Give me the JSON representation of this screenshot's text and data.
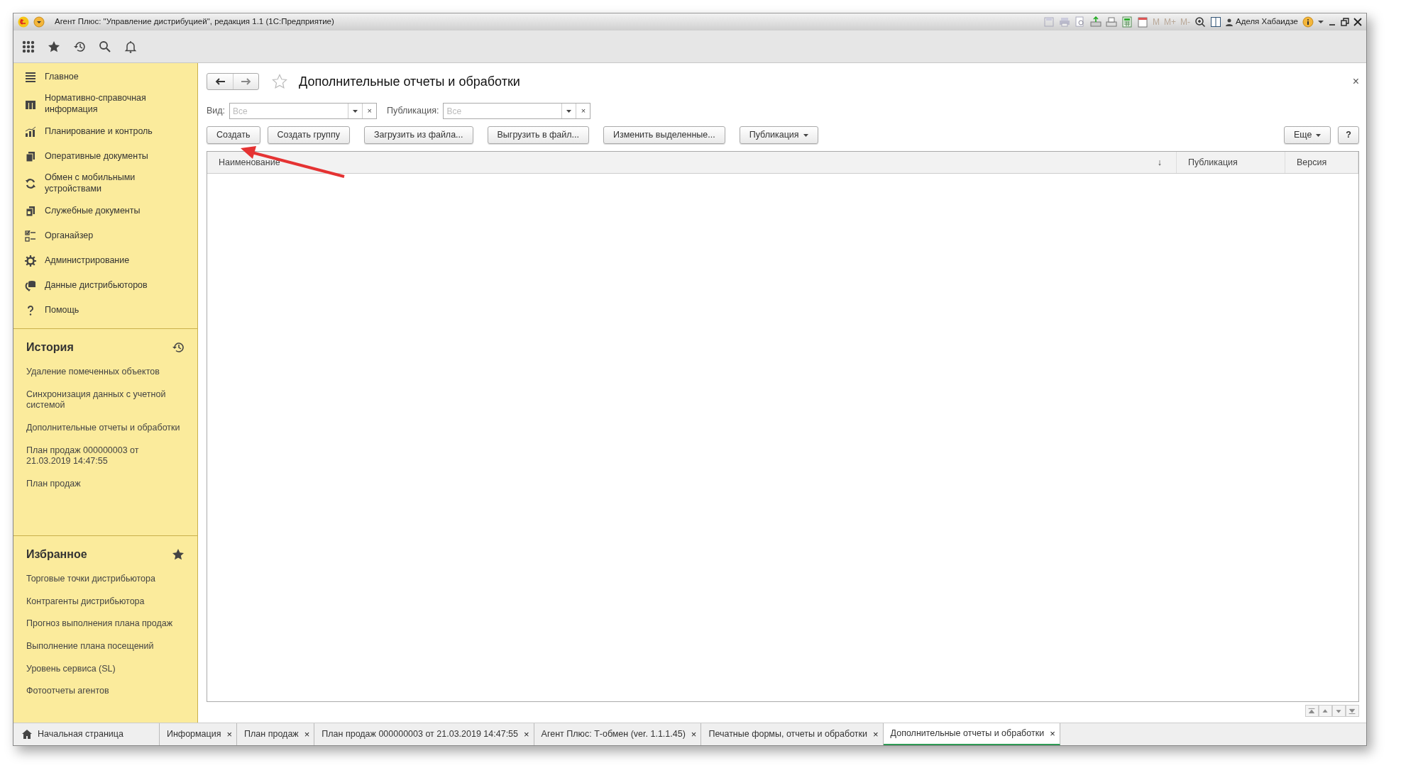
{
  "window": {
    "title": "Агент Плюс: \"Управление дистрибуцией\", редакция 1.1  (1С:Предприятие)",
    "memory_buttons": [
      "M",
      "M+",
      "M-"
    ],
    "user": "Аделя Хабаидзе"
  },
  "sidebar": {
    "items": [
      {
        "label": "Главное"
      },
      {
        "label": "Нормативно-справочная информация"
      },
      {
        "label": "Планирование и контроль"
      },
      {
        "label": "Оперативные документы"
      },
      {
        "label": "Обмен с мобильными устройствами"
      },
      {
        "label": "Служебные документы"
      },
      {
        "label": "Органайзер"
      },
      {
        "label": "Администрирование"
      },
      {
        "label": "Данные дистрибьюторов"
      },
      {
        "label": "Помощь"
      }
    ],
    "history": {
      "title": "История",
      "items": [
        "Удаление помеченных объектов",
        "Синхронизация данных с учетной системой",
        "Дополнительные отчеты и обработки",
        "План продаж 000000003 от 21.03.2019 14:47:55",
        "План продаж"
      ]
    },
    "favorites": {
      "title": "Избранное",
      "items": [
        "Торговые точки дистрибьютора",
        "Контрагенты дистрибьютора",
        "Прогноз выполнения плана продаж",
        "Выполнение плана посещений",
        "Уровень сервиса (SL)",
        "Фотоотчеты агентов"
      ]
    }
  },
  "form": {
    "title": "Дополнительные отчеты и обработки",
    "close": "×",
    "filters": [
      {
        "label": "Вид:",
        "placeholder": "Все",
        "clear": "×"
      },
      {
        "label": "Публикация:",
        "placeholder": "Все",
        "clear": "×"
      }
    ],
    "buttons": [
      {
        "label": "Создать",
        "kind": "plain"
      },
      {
        "label": "Создать группу",
        "kind": "plain"
      },
      {
        "label": "Загрузить из файла...",
        "kind": "plain"
      },
      {
        "label": "Выгрузить в файл...",
        "kind": "plain"
      },
      {
        "label": "Изменить выделенные...",
        "kind": "plain"
      },
      {
        "label": "Публикация",
        "kind": "dropdown"
      }
    ],
    "more_button": {
      "label": "Еще",
      "kind": "dropdown"
    },
    "help_button": "?",
    "table": {
      "columns": [
        {
          "label": "Наименование",
          "sort": "↓"
        },
        {
          "label": "Публикация"
        },
        {
          "label": "Версия"
        }
      ]
    }
  },
  "tabs": [
    {
      "label": "Начальная страница",
      "kind": "home",
      "selected": false
    },
    {
      "label": "Информация",
      "close": "×",
      "selected": false
    },
    {
      "label": "План продаж",
      "close": "×",
      "selected": false
    },
    {
      "label": "План продаж 000000003 от 21.03.2019 14:47:55",
      "close": "×",
      "selected": false
    },
    {
      "label": "Агент Плюс: Т-обмен (ver. 1.1.1.45)",
      "close": "×",
      "selected": false
    },
    {
      "label": "Печатные формы, отчеты и обработки",
      "close": "×",
      "selected": false
    },
    {
      "label": "Дополнительные отчеты и обработки",
      "close": "×",
      "selected": true
    }
  ]
}
